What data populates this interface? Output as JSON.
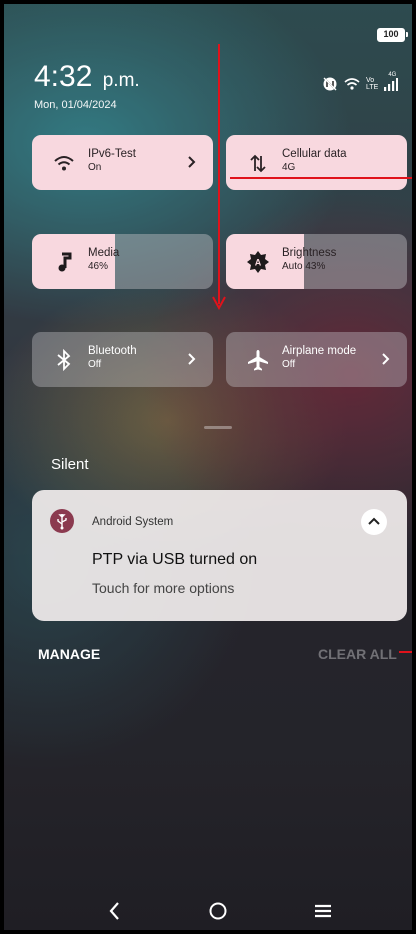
{
  "status_bar": {
    "battery": "100",
    "network_small_a": "Vo",
    "network_small_b": "LTE",
    "network_gen": "4G"
  },
  "clock": {
    "time": "4:32",
    "ampm": "p.m.",
    "date": "Mon, 01/04/2024"
  },
  "quick_tiles": [
    {
      "title": "IPv6-Test",
      "subtitle": "On",
      "state": "active",
      "icon": "wifi-icon",
      "has_chevron": true
    },
    {
      "title": "Cellular data",
      "subtitle": "4G",
      "state": "active",
      "icon": "data-arrows-icon",
      "has_chevron": false
    },
    {
      "title": "Media",
      "subtitle": "46%",
      "state": "slider",
      "level": 0.46,
      "icon": "music-note-icon"
    },
    {
      "title": "Brightness",
      "subtitle": "Auto 43%",
      "state": "slider",
      "level": 0.43,
      "icon": "brightness-auto-icon"
    },
    {
      "title": "Bluetooth",
      "subtitle": "Off",
      "state": "inactive",
      "icon": "bluetooth-icon",
      "has_chevron": true
    },
    {
      "title": "Airplane mode",
      "subtitle": "Off",
      "state": "inactive",
      "icon": "airplane-icon",
      "has_chevron": true
    }
  ],
  "section_label": "Silent",
  "notification": {
    "app_name": "Android System",
    "title": "PTP via USB turned on",
    "text": "Touch for more options",
    "icon": "usb-icon"
  },
  "actions": {
    "manage": "MANAGE",
    "clear_all": "CLEAR ALL"
  },
  "nav": [
    "back-icon",
    "home-icon",
    "menu-icon"
  ],
  "colors": {
    "tile_active": "#f8d8df",
    "annotation_red": "#e0121b",
    "app_icon": "#8b3a4f"
  }
}
